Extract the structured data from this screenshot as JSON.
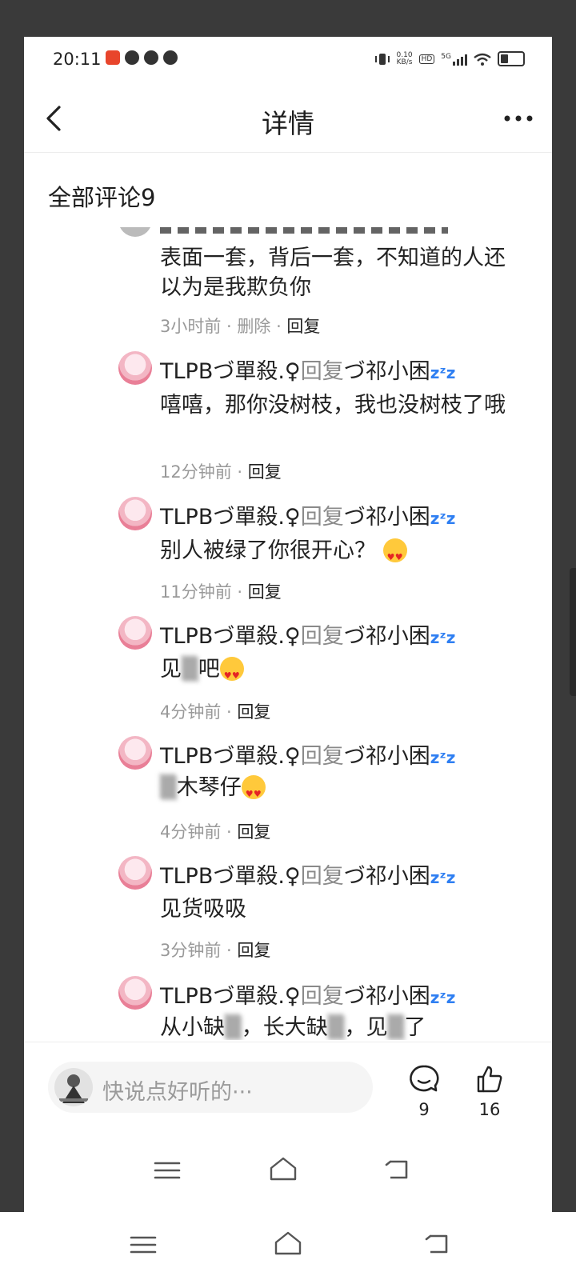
{
  "status_bar": {
    "time": "20:11",
    "net_speed_value": "0.10",
    "net_speed_unit": "KB/s",
    "hd_label": "HD",
    "signal_label": "5G"
  },
  "header": {
    "title": "详情"
  },
  "section": {
    "title": "全部评论9"
  },
  "first_comment": {
    "text": "表面一套，背后一套，不知道的人还以为是我欺负你",
    "time": "3小时前 · ",
    "delete_label": "删除",
    "separator": " · ",
    "reply_label": "回复"
  },
  "replies": [
    {
      "author": "TLPBづ單殺.♀",
      "reply_word": "回复",
      "target": "づ祁小困",
      "zz": "zᶻz",
      "text": "嘻嘻，那你没树枝，我也没树枝了哦",
      "time": "12分钟前 · ",
      "reply_label": "回复"
    },
    {
      "author": "TLPBづ單殺.♀",
      "reply_word": "回复",
      "target": "づ祁小困",
      "zz": "zᶻz",
      "text": "别人被绿了你很开心？",
      "time": "11分钟前 · ",
      "reply_label": "回复"
    },
    {
      "author": "TLPBづ單殺.♀",
      "reply_word": "回复",
      "target": "づ祁小困",
      "zz": "zᶻz",
      "text_a": "见",
      "text_blur": "▒",
      "text_b": "吧",
      "time": "4分钟前 · ",
      "reply_label": "回复"
    },
    {
      "author": "TLPBづ單殺.♀",
      "reply_word": "回复",
      "target": "づ祁小困",
      "zz": "zᶻz",
      "text_blur": "▒",
      "text_b": "木琴仔",
      "time": "4分钟前 · ",
      "reply_label": "回复"
    },
    {
      "author": "TLPBづ單殺.♀",
      "reply_word": "回复",
      "target": "づ祁小困",
      "zz": "zᶻz",
      "text": "见货吸吸",
      "time": "3分钟前 · ",
      "reply_label": "回复"
    },
    {
      "author": "TLPBづ單殺.♀",
      "reply_word": "回复",
      "target": "づ祁小困",
      "zz": "zᶻz",
      "text_a": "从小缺",
      "text_blur1": "▒",
      "text_b": "，长大缺",
      "text_blur2": "▒",
      "text_c": "，见",
      "text_blur3": "▒",
      "text_d": "了"
    }
  ],
  "bottom_bar": {
    "input_placeholder": "快说点好听的···",
    "comment_count": "9",
    "like_count": "16"
  },
  "colors": {
    "accent_blue": "#2f7ff2",
    "muted_text": "#999999",
    "bezel": "#3a3a3a"
  }
}
